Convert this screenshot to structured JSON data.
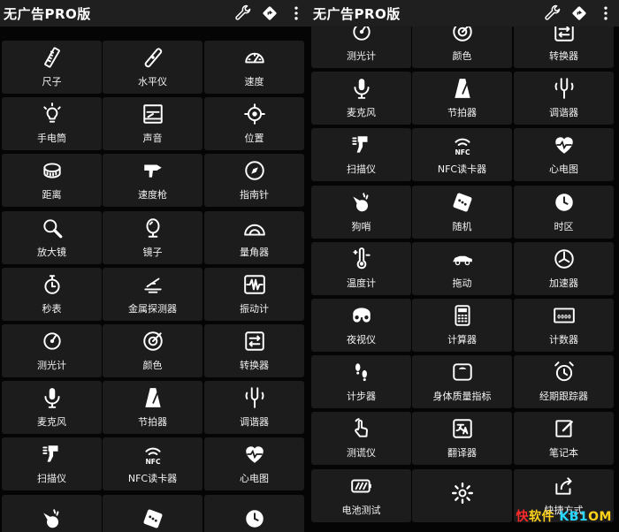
{
  "app": {
    "title": "无广告PRO版",
    "actions": [
      "wrench-icon",
      "diamond-pointer-icon",
      "more-vert-icon"
    ]
  },
  "colors": {
    "background": "#050505",
    "tile": "#1c1c1c",
    "appbar": "#1f1f1f",
    "text": "#ffffff"
  },
  "left_panel": {
    "tiles": [
      {
        "label": "尺子",
        "icon": "ruler-icon"
      },
      {
        "label": "水平仪",
        "icon": "bubble-level-icon"
      },
      {
        "label": "速度",
        "icon": "speedometer-icon"
      },
      {
        "label": "手电筒",
        "icon": "lightbulb-icon"
      },
      {
        "label": "声音",
        "icon": "sound-meter-icon"
      },
      {
        "label": "位置",
        "icon": "location-target-icon"
      },
      {
        "label": "距离",
        "icon": "tape-measure-icon"
      },
      {
        "label": "速度枪",
        "icon": "speed-gun-icon"
      },
      {
        "label": "指南针",
        "icon": "compass-icon"
      },
      {
        "label": "放大镜",
        "icon": "magnifier-icon"
      },
      {
        "label": "镜子",
        "icon": "mirror-icon"
      },
      {
        "label": "量角器",
        "icon": "protractor-icon"
      },
      {
        "label": "秒表",
        "icon": "stopwatch-icon"
      },
      {
        "label": "金属探测器",
        "icon": "metal-detector-icon"
      },
      {
        "label": "振动计",
        "icon": "vibration-meter-icon"
      },
      {
        "label": "测光计",
        "icon": "light-meter-icon"
      },
      {
        "label": "颜色",
        "icon": "color-picker-icon"
      },
      {
        "label": "转换器",
        "icon": "converter-icon"
      },
      {
        "label": "麦克风",
        "icon": "microphone-icon"
      },
      {
        "label": "节拍器",
        "icon": "metronome-icon"
      },
      {
        "label": "调谐器",
        "icon": "tuning-fork-icon"
      },
      {
        "label": "扫描仪",
        "icon": "scanner-icon"
      },
      {
        "label": "NFC读卡器",
        "icon": "nfc-icon"
      },
      {
        "label": "心电图",
        "icon": "heart-ecg-icon"
      },
      {
        "label": "",
        "icon": "whistle-icon"
      },
      {
        "label": "",
        "icon": "dice-icon"
      },
      {
        "label": "",
        "icon": "globe-clock-icon"
      }
    ]
  },
  "right_panel": {
    "tiles": [
      {
        "label": "测光计",
        "icon": "light-meter-icon"
      },
      {
        "label": "颜色",
        "icon": "color-picker-icon"
      },
      {
        "label": "转换器",
        "icon": "converter-icon"
      },
      {
        "label": "麦克风",
        "icon": "microphone-icon"
      },
      {
        "label": "节拍器",
        "icon": "metronome-icon"
      },
      {
        "label": "调谐器",
        "icon": "tuning-fork-icon"
      },
      {
        "label": "扫描仪",
        "icon": "scanner-icon"
      },
      {
        "label": "NFC读卡器",
        "icon": "nfc-icon"
      },
      {
        "label": "心电图",
        "icon": "heart-ecg-icon"
      },
      {
        "label": "狗哨",
        "icon": "whistle-icon"
      },
      {
        "label": "随机",
        "icon": "dice-icon"
      },
      {
        "label": "时区",
        "icon": "globe-clock-icon"
      },
      {
        "label": "温度计",
        "icon": "thermometer-icon"
      },
      {
        "label": "拖动",
        "icon": "car-icon"
      },
      {
        "label": "加速器",
        "icon": "accelerometer-icon"
      },
      {
        "label": "夜视仪",
        "icon": "night-vision-icon"
      },
      {
        "label": "计算器",
        "icon": "calculator-icon"
      },
      {
        "label": "计数器",
        "icon": "counter-icon"
      },
      {
        "label": "计步器",
        "icon": "footsteps-icon"
      },
      {
        "label": "身体质量指标",
        "icon": "scale-icon"
      },
      {
        "label": "经期跟踪器",
        "icon": "alarm-clock-icon"
      },
      {
        "label": "测谎仪",
        "icon": "finger-touch-icon"
      },
      {
        "label": "翻译器",
        "icon": "translate-icon"
      },
      {
        "label": "笔记本",
        "icon": "notepad-icon"
      },
      {
        "label": "电池测试",
        "icon": "battery-icon"
      },
      {
        "label": "",
        "icon": "settings-gear-icon"
      },
      {
        "label": "快捷方式",
        "icon": "share-icon"
      }
    ]
  },
  "watermark": {
    "part1": "快",
    "part2": "软件",
    "part3": "KB1",
    "part4": "OM"
  }
}
